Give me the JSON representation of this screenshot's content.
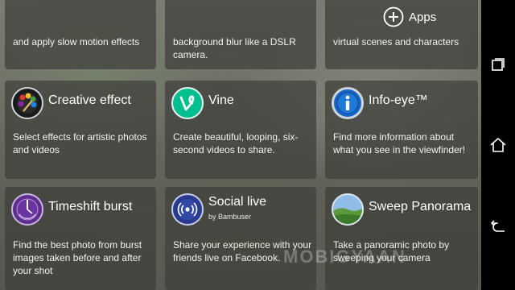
{
  "header": {
    "apps_label": "Apps"
  },
  "top_cards": [
    {
      "desc": "and apply slow motion effects"
    },
    {
      "desc": "background blur like a DSLR camera."
    },
    {
      "desc": "virtual scenes and characters"
    }
  ],
  "cards": [
    {
      "title": "Creative effect",
      "subtitle": "",
      "desc": "Select effects for artistic photos and videos",
      "icon": "palette-icon"
    },
    {
      "title": "Vine",
      "subtitle": "",
      "desc": "Create beautiful, looping, six-second videos to share.",
      "icon": "vine-icon"
    },
    {
      "title": "Info-eye™",
      "subtitle": "",
      "desc": "Find more information about what you see in the viewfinder!",
      "icon": "info-icon"
    },
    {
      "title": "Timeshift burst",
      "subtitle": "",
      "desc": "Find the best photo from burst images taken before and after your shot",
      "icon": "timeshift-icon"
    },
    {
      "title": "Social live",
      "subtitle": "by Bambuser",
      "desc": "Share your experience with your friends live on Facebook.",
      "icon": "broadcast-icon"
    },
    {
      "title": "Sweep Panorama",
      "subtitle": "",
      "desc": "Take a panoramic photo by sweeping your camera",
      "icon": "panorama-icon"
    }
  ],
  "watermark": "MOBIGYAAN",
  "nav": {
    "icons": [
      "recent-apps-icon",
      "home-icon",
      "back-icon"
    ]
  }
}
